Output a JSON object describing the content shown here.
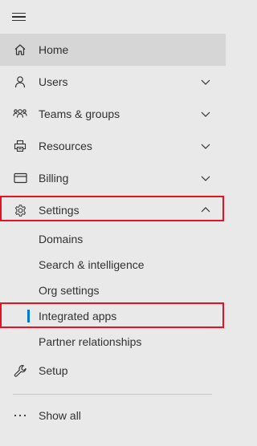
{
  "nav": {
    "items": [
      {
        "label": "Home",
        "icon": "home-icon"
      },
      {
        "label": "Users",
        "icon": "user-icon"
      },
      {
        "label": "Teams & groups",
        "icon": "teams-icon"
      },
      {
        "label": "Resources",
        "icon": "printer-icon"
      },
      {
        "label": "Billing",
        "icon": "card-icon"
      },
      {
        "label": "Settings",
        "icon": "gear-icon"
      }
    ],
    "settings_sub": [
      {
        "label": "Domains"
      },
      {
        "label": "Search & intelligence"
      },
      {
        "label": "Org settings"
      },
      {
        "label": "Integrated apps"
      },
      {
        "label": "Partner relationships"
      }
    ],
    "setup": {
      "label": "Setup",
      "icon": "wrench-icon"
    },
    "show_all": {
      "label": "Show all",
      "icon": "ellipsis-icon"
    }
  },
  "colors": {
    "background": "#e9e9e9",
    "selected_background": "#d6d6d6",
    "highlight_border": "#e81123",
    "active_indicator": "#0078d4",
    "text": "#323130"
  }
}
